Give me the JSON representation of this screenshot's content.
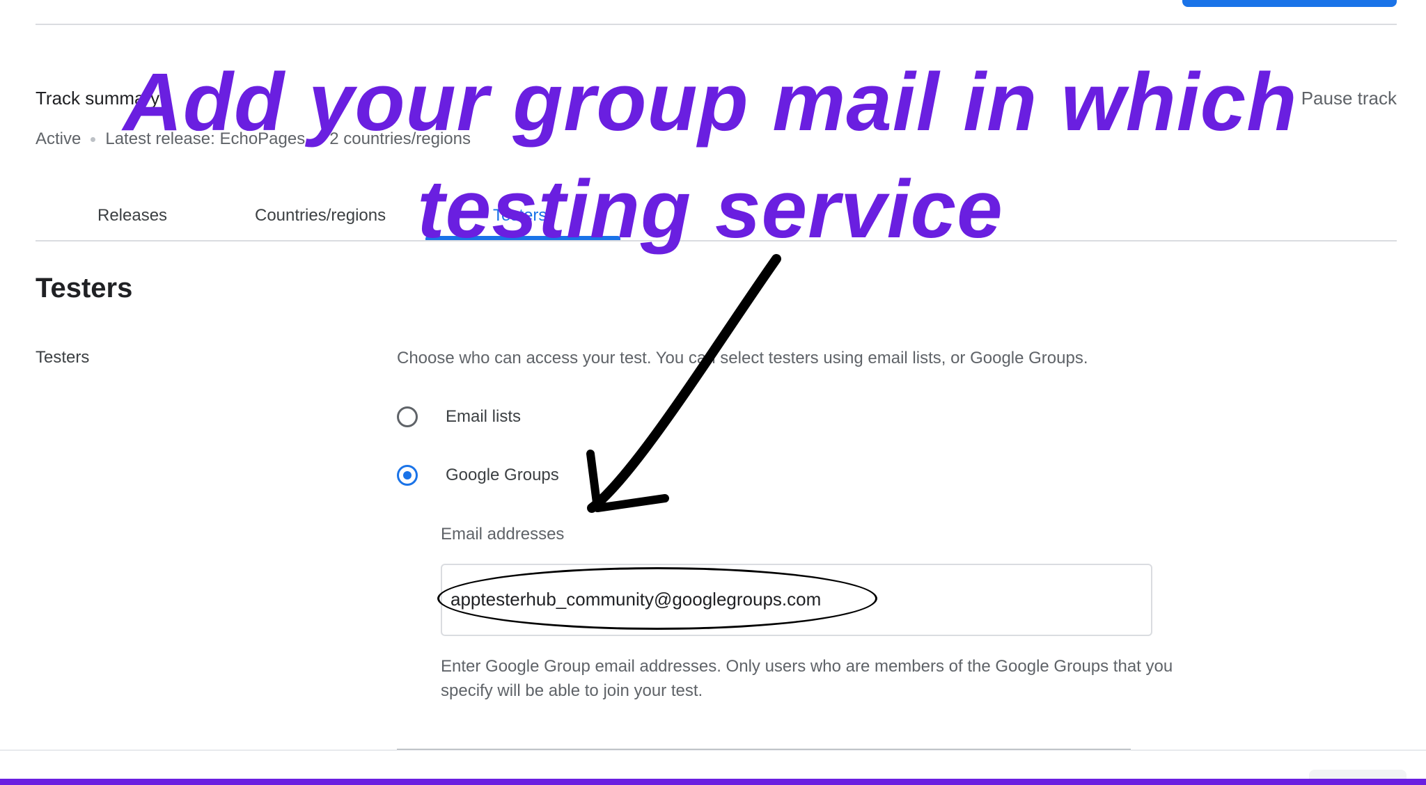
{
  "header": {
    "track_title": "Track summary",
    "pause_link": "Pause track",
    "summary": {
      "status": "Active",
      "latest_release": "Latest release: EchoPages",
      "countries": "2 countries/regions"
    }
  },
  "tabs": [
    {
      "label": "Releases",
      "active": false
    },
    {
      "label": "Countries/regions",
      "active": false
    },
    {
      "label": "Testers",
      "active": true
    }
  ],
  "testers_section": {
    "heading": "Testers",
    "side_label": "Testers",
    "description": "Choose who can access your test. You can select testers using email lists, or Google Groups.",
    "options": [
      {
        "label": "Email lists",
        "selected": false
      },
      {
        "label": "Google Groups",
        "selected": true
      }
    ],
    "email_field": {
      "label": "Email addresses",
      "value": "apptesterhub_community@googlegroups.com"
    },
    "help_text": "Enter Google Group email addresses. Only users who are members of the Google Groups that you specify will be able to join your test."
  },
  "overlay": {
    "caption": "Add your group mail in which testing service",
    "caption_color": "#6a1fe0"
  },
  "colors": {
    "accent": "#1a73e8",
    "brand_bar": "#6a1fe0"
  }
}
